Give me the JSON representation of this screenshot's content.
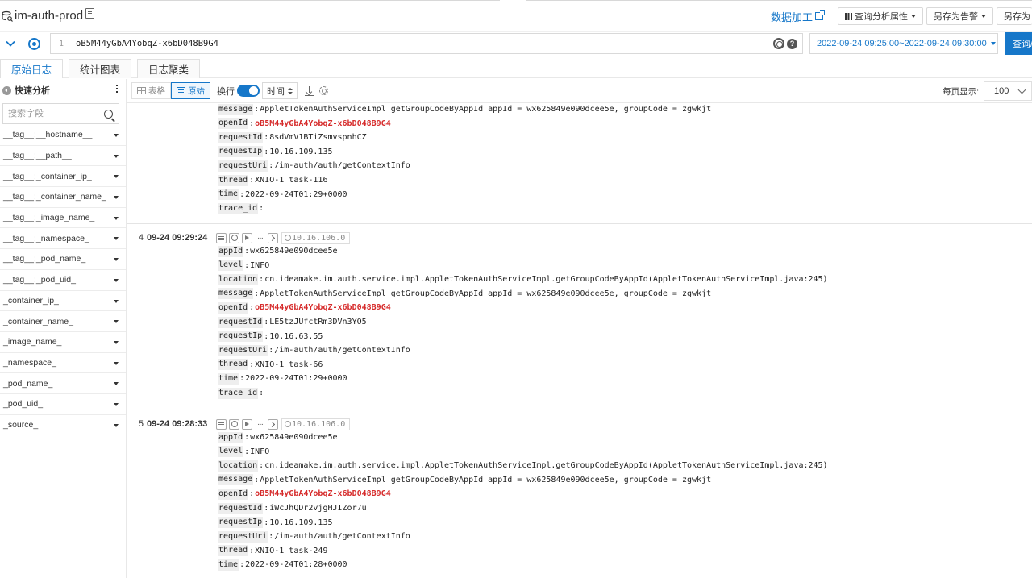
{
  "header": {
    "logstore_title": "im-auth-prod",
    "data_process_label": "数据加工",
    "query_analysis_props_label": "查询分析属性",
    "save_alert_label": "另存为告警",
    "save_as_label": "另存为"
  },
  "query": {
    "line_number": "1",
    "text": "oB5M44yGbA4YobqZ-x6bD048B9G4",
    "time_range": "2022-09-24 09:25:00~2022-09-24 09:30:00",
    "submit_label": "查询/"
  },
  "tabs": [
    {
      "label": "原始日志",
      "active": true
    },
    {
      "label": "统计图表",
      "active": false
    },
    {
      "label": "日志聚类",
      "active": false
    }
  ],
  "sidebar": {
    "title": "快速分析",
    "search_placeholder": "搜索字段",
    "fields": [
      "__tag__:__hostname__",
      "__tag__:__path__",
      "__tag__:_container_ip_",
      "__tag__:_container_name_",
      "__tag__:_image_name_",
      "__tag__:_namespace_",
      "__tag__:_pod_name_",
      "__tag__:_pod_uid_",
      "_container_ip_",
      "_container_name_",
      "_image_name_",
      "_namespace_",
      "_pod_name_",
      "_pod_uid_",
      "_source_"
    ]
  },
  "toolbar": {
    "table_label": "表格",
    "raw_label": "原始",
    "wrap_label": "换行",
    "wrap_on": true,
    "sort_label": "时间",
    "per_page_label": "每页显示:",
    "per_page_value": "100"
  },
  "logs": [
    {
      "index": "",
      "time": "",
      "ip": "",
      "fields": [
        {
          "k": "message",
          "v": "AppletTokenAuthServiceImpl getGroupCodeByAppId appId = wx625849e090dcee5e, groupCode = zgwkjt"
        },
        {
          "k": "openId",
          "v": "oB5M44yGbA4YobqZ-x6bD048B9G4",
          "hl": true
        },
        {
          "k": "requestId",
          "v": "8sdVmV1BTiZsmvspnhCZ"
        },
        {
          "k": "requestIp",
          "v": "10.16.109.135"
        },
        {
          "k": "requestUri",
          "v": "/im-auth/auth/getContextInfo"
        },
        {
          "k": "thread",
          "v": "XNIO-1 task-116"
        },
        {
          "k": "time",
          "v": "2022-09-24T01:29+0000"
        },
        {
          "k": "trace_id",
          "v": ""
        }
      ]
    },
    {
      "index": "4",
      "time": "09-24 09:29:24",
      "ip": "10.16.106.0",
      "fields": [
        {
          "k": "appId",
          "v": "wx625849e090dcee5e"
        },
        {
          "k": "level",
          "v": "INFO"
        },
        {
          "k": "location",
          "v": "cn.ideamake.im.auth.service.impl.AppletTokenAuthServiceImpl.getGroupCodeByAppId(AppletTokenAuthServiceImpl.java:245)"
        },
        {
          "k": "message",
          "v": "AppletTokenAuthServiceImpl getGroupCodeByAppId appId = wx625849e090dcee5e, groupCode = zgwkjt"
        },
        {
          "k": "openId",
          "v": "oB5M44yGbA4YobqZ-x6bD048B9G4",
          "hl": true
        },
        {
          "k": "requestId",
          "v": "LE5tzJUfctRm3DVn3YO5"
        },
        {
          "k": "requestIp",
          "v": "10.16.63.55"
        },
        {
          "k": "requestUri",
          "v": "/im-auth/auth/getContextInfo"
        },
        {
          "k": "thread",
          "v": "XNIO-1 task-66"
        },
        {
          "k": "time",
          "v": "2022-09-24T01:29+0000"
        },
        {
          "k": "trace_id",
          "v": ""
        }
      ]
    },
    {
      "index": "5",
      "time": "09-24 09:28:33",
      "ip": "10.16.106.0",
      "fields": [
        {
          "k": "appId",
          "v": "wx625849e090dcee5e"
        },
        {
          "k": "level",
          "v": "INFO"
        },
        {
          "k": "location",
          "v": "cn.ideamake.im.auth.service.impl.AppletTokenAuthServiceImpl.getGroupCodeByAppId(AppletTokenAuthServiceImpl.java:245)"
        },
        {
          "k": "message",
          "v": "AppletTokenAuthServiceImpl getGroupCodeByAppId appId = wx625849e090dcee5e, groupCode = zgwkjt"
        },
        {
          "k": "openId",
          "v": "oB5M44yGbA4YobqZ-x6bD048B9G4",
          "hl": true
        },
        {
          "k": "requestId",
          "v": "iWcJhQDr2vjgHJIZor7u"
        },
        {
          "k": "requestIp",
          "v": "10.16.109.135"
        },
        {
          "k": "requestUri",
          "v": "/im-auth/auth/getContextInfo"
        },
        {
          "k": "thread",
          "v": "XNIO-1 task-249"
        },
        {
          "k": "time",
          "v": "2022-09-24T01:28+0000"
        }
      ]
    }
  ]
}
